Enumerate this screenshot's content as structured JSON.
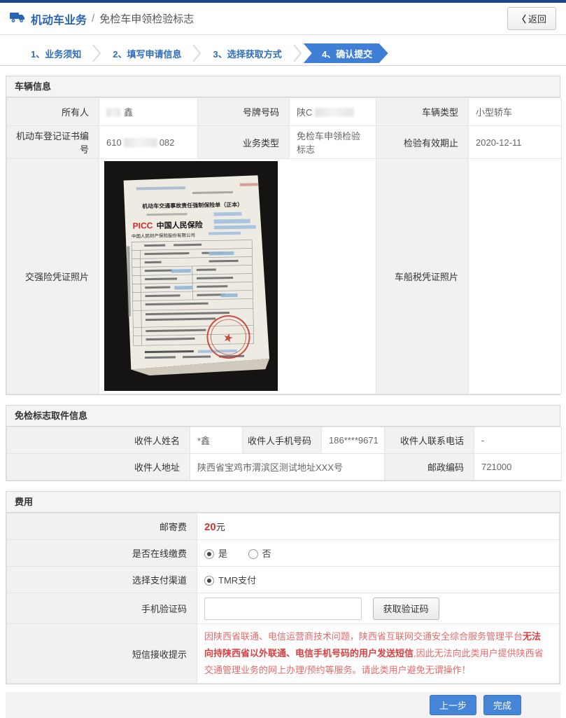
{
  "colors": {
    "top_bar": "#1f4788",
    "accent_blue": "#3f80d6",
    "title_blue": "#2a64b5",
    "danger_red": "#d9332e",
    "tip_red": "#e66a6a"
  },
  "header": {
    "title": "机动车业务",
    "separator": "/",
    "subtitle": "免检车申领检验标志",
    "back_icon": "〈",
    "back_label": "返回"
  },
  "steps": [
    {
      "label": "1、业务须知"
    },
    {
      "label": "2、填写申请信息"
    },
    {
      "label": "3、选择获取方式"
    },
    {
      "label": "4、确认提交"
    }
  ],
  "vehicle": {
    "title": "车辆信息",
    "owner_label": "所有人",
    "owner_value": "鑫",
    "plate_label": "号牌号码",
    "plate_value": "陕C",
    "type_label": "车辆类型",
    "type_value": "小型轿车",
    "cert_label": "机动车登记证书编号",
    "cert_prefix": "610",
    "cert_suffix": "082",
    "business_label": "业务类型",
    "business_value": "免检车申领检验标志",
    "valid_label": "检验有效期止",
    "valid_value": "2020-12-11",
    "insurance_photo_label": "交强险凭证照片",
    "tax_photo_label": "车船税凭证照片",
    "photo": {
      "doc_title": "机动车交通事故责任强制保险单（正本）",
      "brand": "PICC",
      "brand_name": "中国人民保险",
      "company": "中国人民财产保险股份有限公司",
      "stamp_glyph": "★"
    }
  },
  "pickup": {
    "title": "免检标志取件信息",
    "name_label": "收件人姓名",
    "name_value": "*鑫",
    "mobile_label": "收件人手机号码",
    "mobile_value": "186****9671",
    "phone_label": "收件人联系电话",
    "phone_value": "-",
    "address_label": "收件人地址",
    "address_value": "陕西省宝鸡市渭滨区测试地址XXX号",
    "zip_label": "邮政编码",
    "zip_value": "721000"
  },
  "fees": {
    "title": "费用",
    "postage_label": "邮寄费",
    "postage_value": "20",
    "postage_unit": "元",
    "online_label": "是否在线缴费",
    "online_yes": "是",
    "online_no": "否",
    "channel_label": "选择支付渠道",
    "channel_option": "TMR支付",
    "sms_code_label": "手机验证码",
    "get_code_label": "获取验证码",
    "tip_label": "短信接收提示",
    "tip_part1": "因陕西省联通、电信运营商技术问题，陕西省互联网交通安全综合服务管理平台",
    "tip_part2": "无法向持陕西省以外联通、电信手机号码的用户发送短信",
    "tip_part3": ",因此无法向此类用户提供陕西省交通管理业务的网上办理/预约等服务。请此类用户避免无谓操作！"
  },
  "footer": {
    "prev_label": "上一步",
    "done_label": "完成"
  }
}
